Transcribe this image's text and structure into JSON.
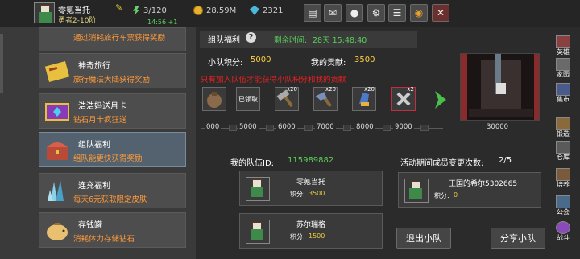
{
  "topbar": {
    "player_name": "零氪当托",
    "rank": "勇者2-10阶",
    "stamina": "3/120",
    "stamina_timer": "14:56 +1",
    "gold": "28.59M",
    "gems": "2321",
    "icons": [
      "edit-icon",
      "shop-icon",
      "mail-icon",
      "controller-icon",
      "settings-icon",
      "notice-icon",
      "palette-icon",
      "close-icon"
    ]
  },
  "event_list": [
    {
      "title": "",
      "desc": "通过消耗旅行车票获得奖励",
      "icon": "ticket-icon"
    },
    {
      "title": "神奇旅行",
      "desc": "旅行魔法大陆获得奖励",
      "icon": "travel-ticket-icon"
    },
    {
      "title": "浩浩妈送月卡",
      "desc": "钻石月卡疯狂送",
      "icon": "monthly-card-icon"
    },
    {
      "title": "组队福利",
      "desc": "组队能更快获得奖励",
      "icon": "treasure-chest-icon",
      "selected": true
    },
    {
      "title": "连充福利",
      "desc": "每天6元获取限定皮肤",
      "icon": "crystal-icon"
    },
    {
      "title": "存钱罐",
      "desc": "消耗体力存储钻石",
      "icon": "piggy-bank-icon"
    }
  ],
  "team_event": {
    "title": "组队福利",
    "time_label": "剩余时间:",
    "time_value": "28天 15:48:40",
    "team_points_label": "小队积分:",
    "team_points": "5000",
    "contribution_label": "我的贡献:",
    "contribution": "3500",
    "warning": "只有加入队伍才能获得小队积分和我的贡献",
    "rewards": [
      {
        "name": "pouch-reward",
        "count": ""
      },
      {
        "name": "claimed-reward",
        "count": "",
        "label": "已领取"
      },
      {
        "name": "hammer-reward",
        "count": "x20"
      },
      {
        "name": "axe-reward",
        "count": "x20"
      },
      {
        "name": "gauntlet-reward",
        "count": "x20"
      },
      {
        "name": "skill-tome-reward",
        "count": "x2"
      }
    ],
    "milestones": [
      "000",
      "5000",
      "6000",
      "7000",
      "8000",
      "9000",
      "30000"
    ],
    "progress_fraction": 1.0
  },
  "team": {
    "id_label": "我的队伍ID:",
    "id": "115989882",
    "changes_label": "活动期间成员变更次数:",
    "changes": "2/5",
    "members": [
      {
        "name": "零氪当托",
        "points_label": "积分:",
        "points": "3500"
      },
      {
        "name": "苏尔瑞格",
        "points_label": "积分:",
        "points": "1500"
      },
      {
        "name": "王国的希尔5302665",
        "points_label": "积分:",
        "points": "0"
      }
    ],
    "leave_label": "退出小队",
    "share_label": "分享小队"
  },
  "sidebar": [
    {
      "label": "英雄",
      "icon": "hero-icon"
    },
    {
      "label": "家园",
      "icon": "home-icon"
    },
    {
      "label": "集市",
      "icon": "market-icon"
    },
    {
      "label": "锻造",
      "icon": "forge-icon"
    },
    {
      "label": "仓库",
      "icon": "storage-icon"
    },
    {
      "label": "培养",
      "icon": "training-icon"
    },
    {
      "label": "公会",
      "icon": "guild-icon"
    },
    {
      "label": "战斗",
      "icon": "battle-icon"
    }
  ],
  "colors": {
    "accent_green": "#5ad05a",
    "warning_red": "#e82020",
    "gold_text": "#ffd040",
    "desc_orange": "#ff9a3a"
  }
}
